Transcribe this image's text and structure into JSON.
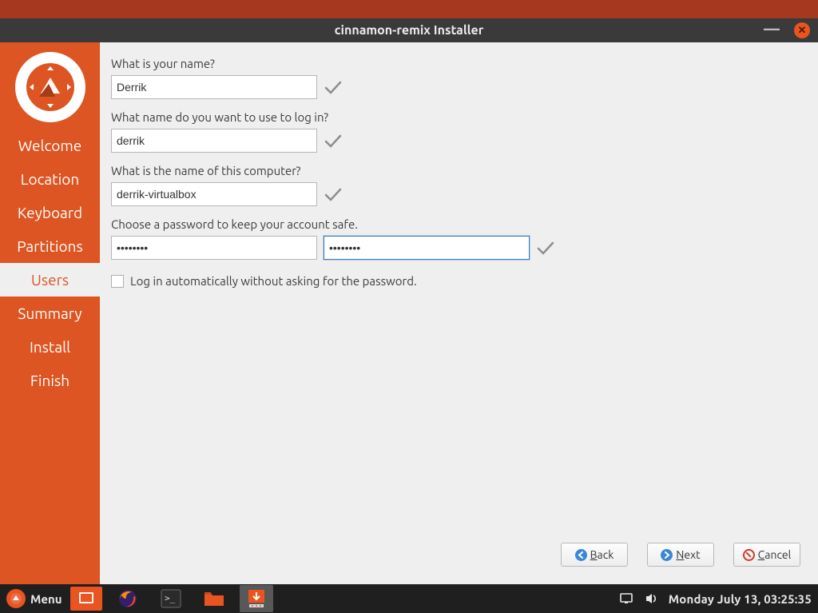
{
  "window": {
    "title": "cinnamon-remix Installer"
  },
  "sidebar": {
    "items": [
      {
        "label": "Welcome"
      },
      {
        "label": "Location"
      },
      {
        "label": "Keyboard"
      },
      {
        "label": "Partitions"
      },
      {
        "label": "Users"
      },
      {
        "label": "Summary"
      },
      {
        "label": "Install"
      },
      {
        "label": "Finish"
      }
    ],
    "current_index": 4
  },
  "form": {
    "name": {
      "label": "What is your name?",
      "value": "Derrik"
    },
    "login": {
      "label": "What name do you want to use to log in?",
      "value": "derrik"
    },
    "hostname": {
      "label": "What is the name of this computer?",
      "value": "derrik-virtualbox"
    },
    "password": {
      "label": "Choose a password to keep your account safe.",
      "value1": "••••••••",
      "value2": "••••••••"
    },
    "autologin": {
      "label": "Log in automatically without asking for the password.",
      "checked": false
    }
  },
  "buttons": {
    "back": "Back",
    "next": "Next",
    "cancel": "Cancel"
  },
  "taskbar": {
    "menu_label": "Menu",
    "clock": "Monday July 13, 03:25:35"
  }
}
